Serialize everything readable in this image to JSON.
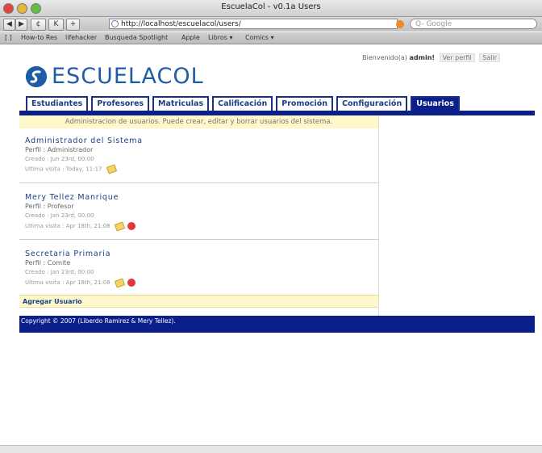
{
  "window": {
    "title": "EscuelaCol - v0.1a Users"
  },
  "toolbar": {
    "back": "◀",
    "forward": "▶",
    "reload": "¢",
    "reader": "K",
    "add": "+",
    "url": "http://localhost/escuelacol/users/",
    "search_placeholder": "Q- Google"
  },
  "bookmarks": [
    "[ ]",
    "How-to Res",
    "lifehacker",
    "Busqueda Spotlight",
    "Apple",
    "Libros ▾",
    "Comics ▾"
  ],
  "header": {
    "welcome": "Bienvenido(a)",
    "user": "admin!",
    "profile_link": "Ver perfil",
    "logout_link": "Salir"
  },
  "logo": {
    "text": "ESCUELACOL"
  },
  "nav": {
    "tabs": [
      "Estudiantes",
      "Profesores",
      "Matriculas",
      "Calificación",
      "Promoción",
      "Configuración",
      "Usuarios"
    ]
  },
  "banner": "Administracion de usuarios. Puede crear, editar y borrar usuarios del sistema.",
  "users": [
    {
      "name": "Administrador del Sistema",
      "profile": "Perfil : Administrador",
      "created": "Creado : Jun 23rd, 00:00",
      "last": "Ultima visita : Today, 11:17"
    },
    {
      "name": "Mery Tellez Manrique",
      "profile": "Perfil : Profesor",
      "created": "Creado : Jan 23rd, 00:00",
      "last": "Ultima visita : Apr 18th, 21:08"
    },
    {
      "name": "Secretaria Primaria",
      "profile": "Perfil : Comite",
      "created": "Creado : Jan 23rd, 00:00",
      "last": "Ultima visita : Apr 18th, 21:08"
    }
  ],
  "add_user": "Agregar Usuario",
  "footer": "Copyright © 2007 (Liberdo Ramirez & Mery Tellez)."
}
